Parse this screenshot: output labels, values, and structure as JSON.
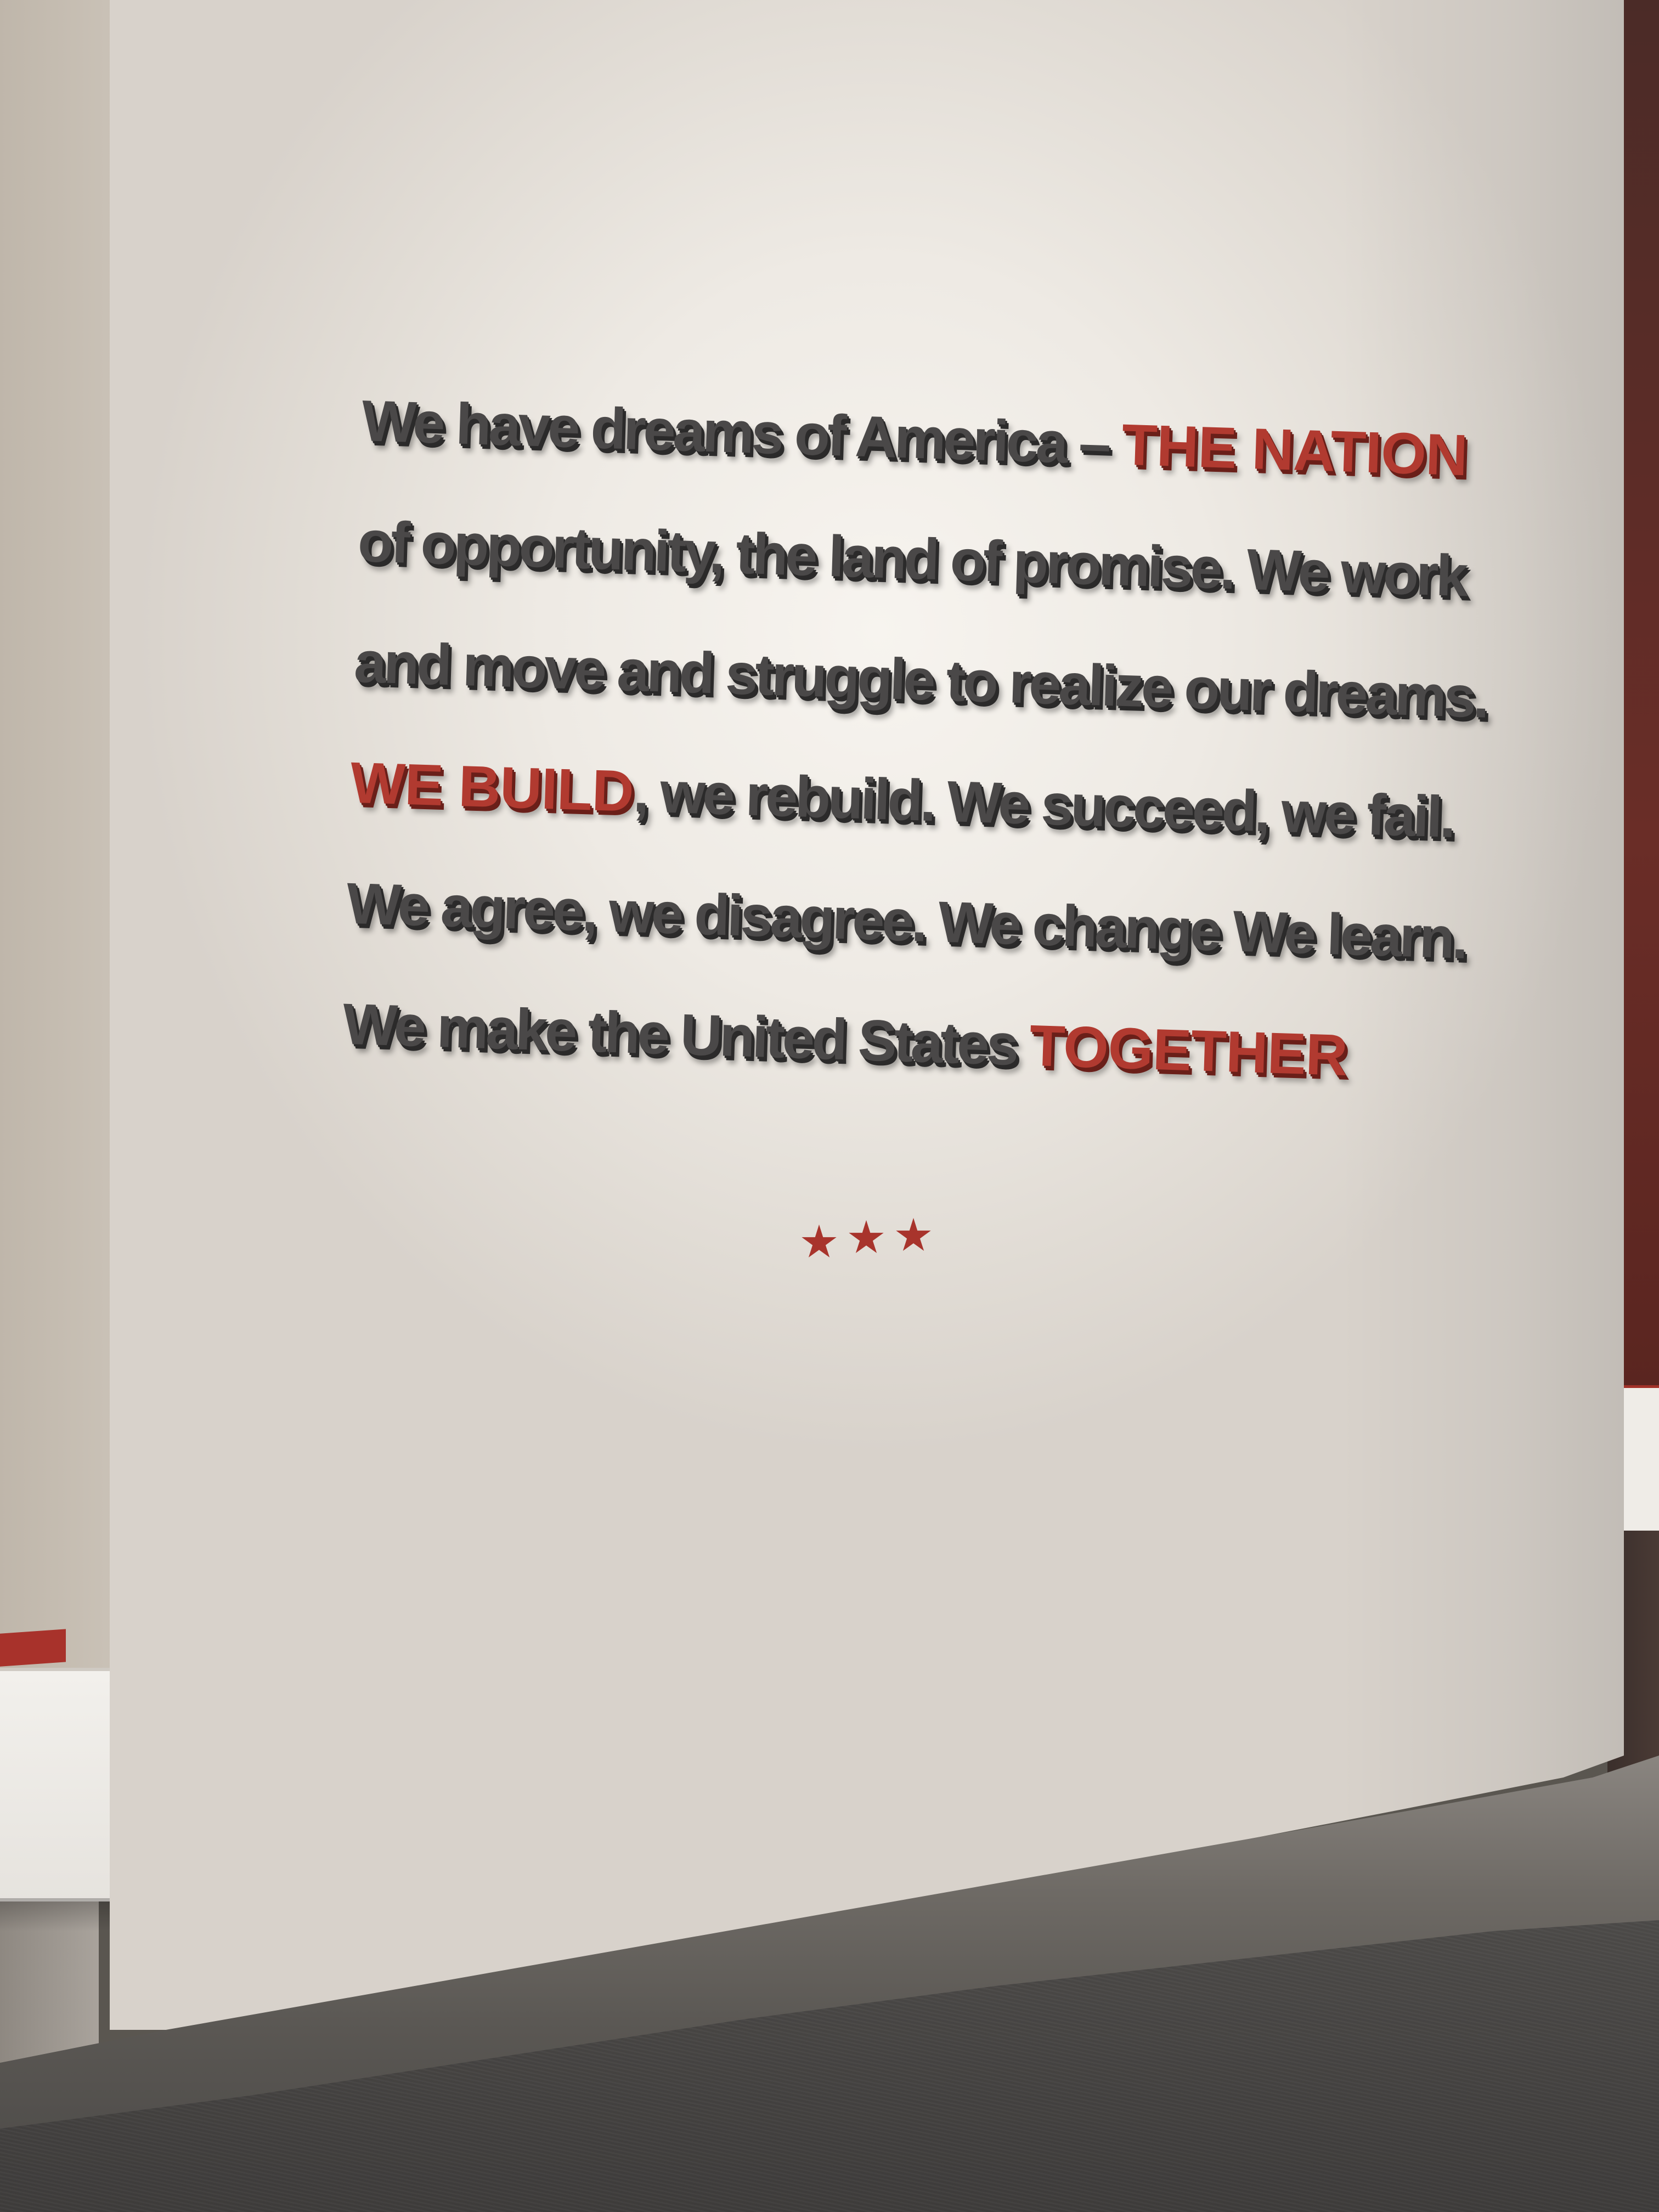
{
  "quote": {
    "line1": {
      "a": "We have dreams of America – ",
      "b": "THE NATION"
    },
    "line2": "of opportunity, the land of promise. We work",
    "line3": "and move and struggle to realize our dreams.",
    "line4": {
      "a": "WE BUILD",
      "b": ", we rebuild. We succeed, we fail."
    },
    "line5": "We agree, we disagree. We change We learn.",
    "line6": {
      "a": "We make the United States ",
      "b": "TOGETHER"
    }
  },
  "colors": {
    "wall": "#f3f0eb",
    "text_dark": "#4a4848",
    "text_red": "#b13a30"
  },
  "decorations": {
    "stars_count": 3,
    "star_icon": "star-icon"
  }
}
